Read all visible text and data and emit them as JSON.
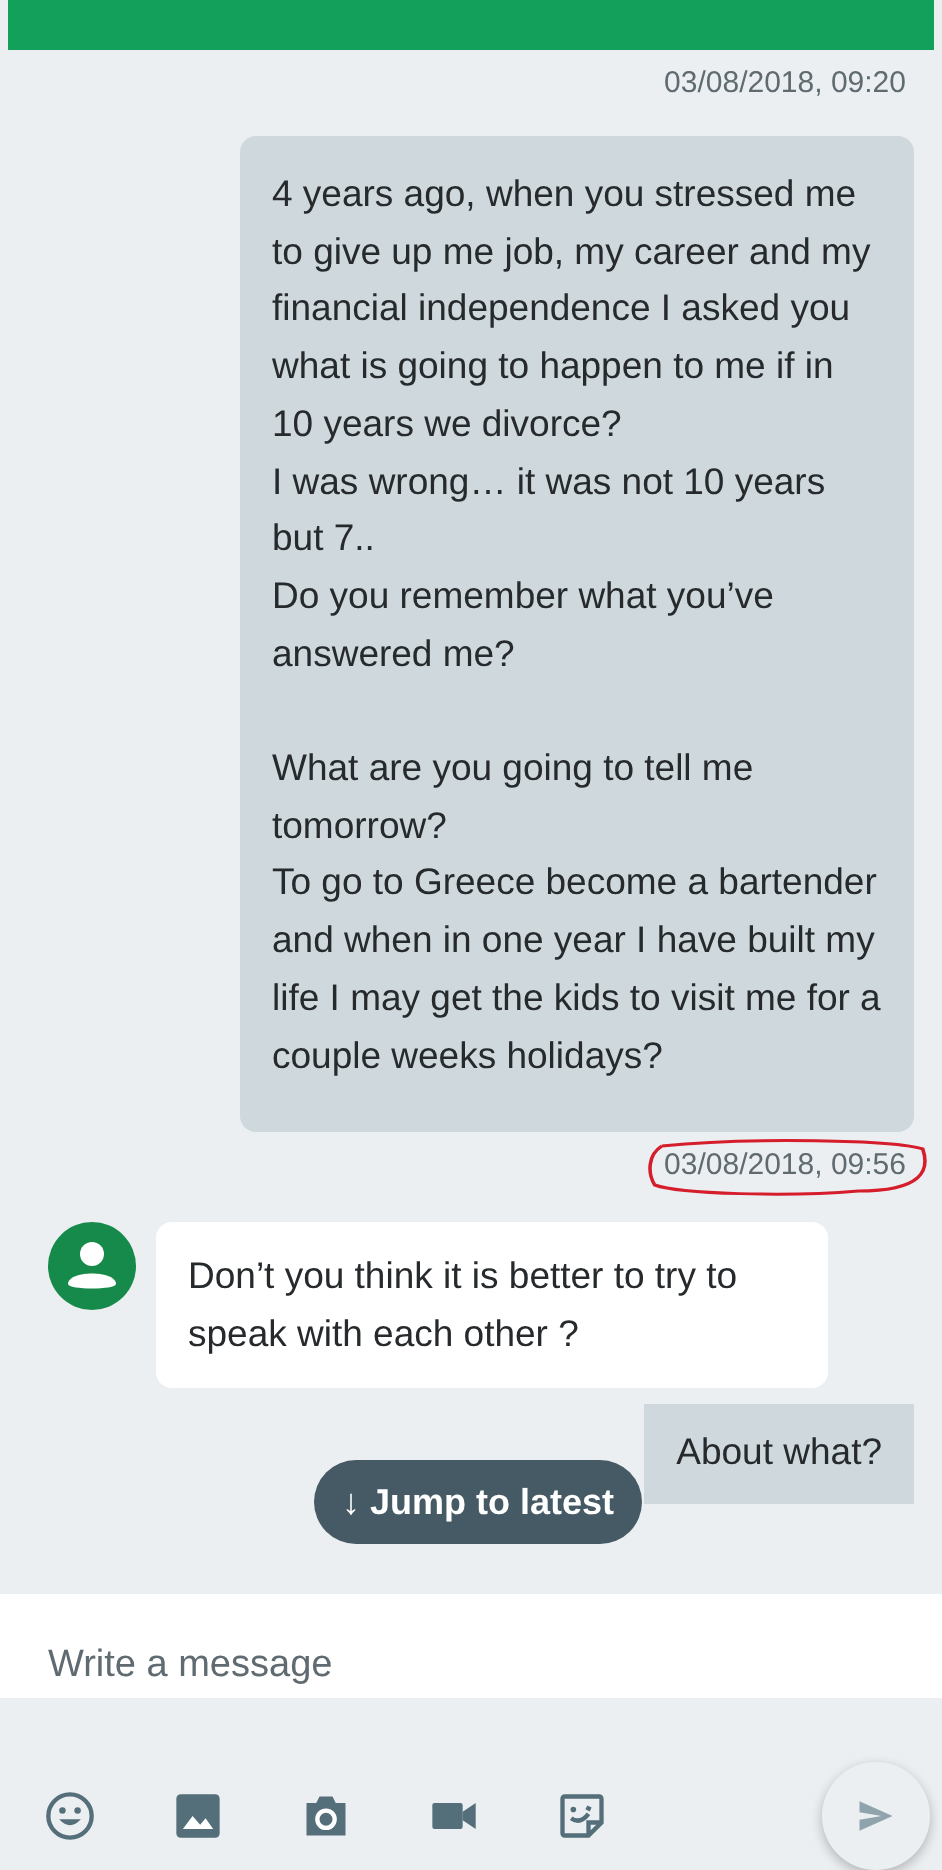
{
  "top_timestamp": "03/08/2018, 09:20",
  "messages": [
    {
      "kind": "outgoing",
      "text": "4 years ago, when you stressed me to give up me job, my career and my financial independence I asked you what is going to happen to me if in 10 years we divorce?\nI was wrong… it was not 10 years but 7..\nDo you remember what you’ve answered me?\n\nWhat are you going to tell me tomorrow?\nTo go to Greece become a bartender and when in one year I have built my life I may get the kids to visit me for a couple weeks holidays?",
      "timestamp": "03/08/2018, 09:56",
      "circled": true
    },
    {
      "kind": "incoming",
      "text": "Don’t you think it is better to try to speak with each other ?"
    },
    {
      "kind": "outgoing",
      "text": "About what?"
    }
  ],
  "jump_button": {
    "icon": "↓",
    "label": "Jump to latest"
  },
  "composer": {
    "placeholder": "Write a message"
  }
}
